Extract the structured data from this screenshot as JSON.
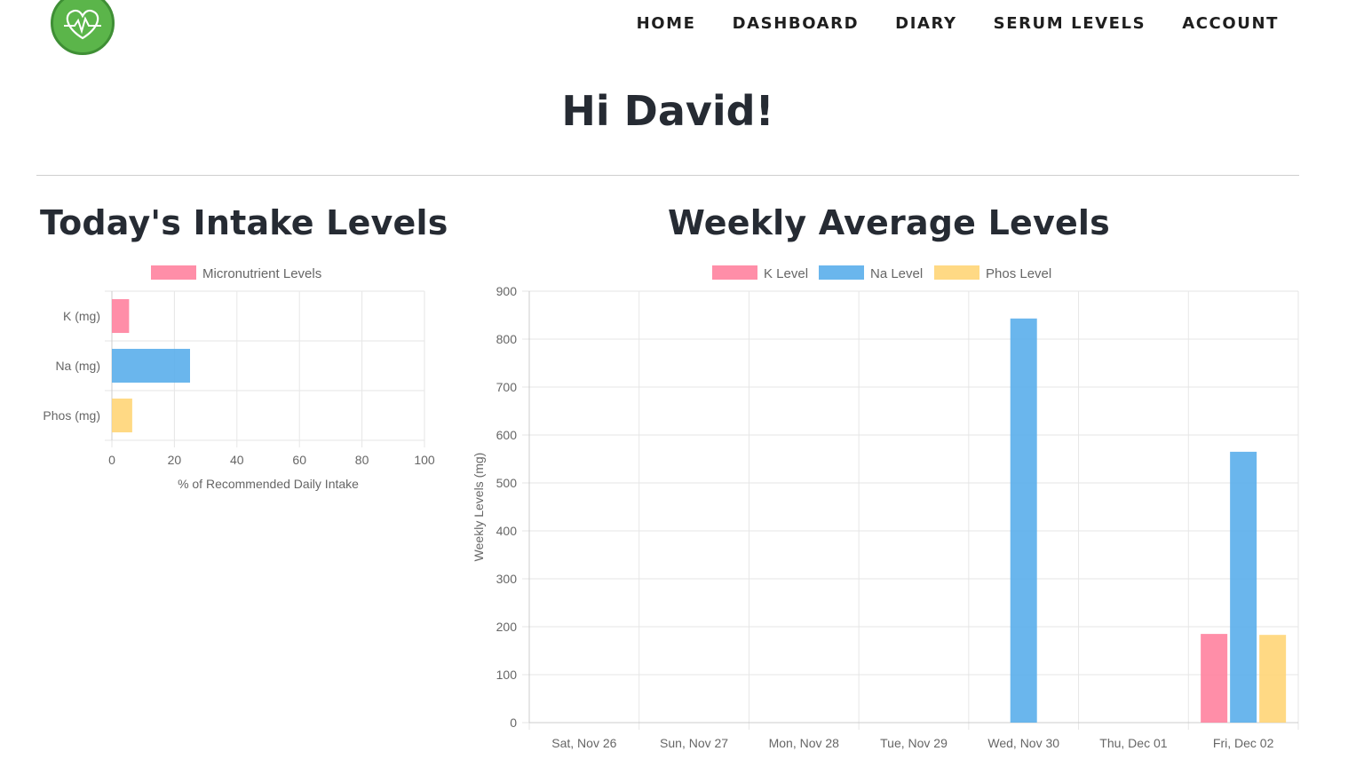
{
  "nav": {
    "items": [
      "HOME",
      "DASHBOARD",
      "DIARY",
      "SERUM LEVELS",
      "ACCOUNT"
    ]
  },
  "greeting": "Hi David!",
  "sections": {
    "today_title": "Today's Intake Levels",
    "weekly_title": "Weekly Average Levels"
  },
  "colors": {
    "logo": "#5bb54a",
    "k": "#ff829f",
    "na": "#5aaeeb",
    "phos": "#ffd577"
  },
  "chart_data": [
    {
      "type": "bar",
      "orientation": "horizontal",
      "categories": [
        "K (mg)",
        "Na (mg)",
        "Phos (mg)"
      ],
      "series": [
        {
          "name": "Micronutrient Levels",
          "values": [
            5.5,
            25,
            6.5
          ],
          "colors": [
            "#ff829f",
            "#5aaeeb",
            "#ffd577"
          ]
        }
      ],
      "xlabel": "% of Recommended Daily Intake",
      "ylabel": "",
      "xlim": [
        0,
        100
      ],
      "xticks": [
        0,
        20,
        40,
        60,
        80,
        100
      ],
      "legend": "top",
      "grid": true
    },
    {
      "type": "bar",
      "categories": [
        "Sat, Nov 26",
        "Sun, Nov 27",
        "Mon, Nov 28",
        "Tue, Nov 29",
        "Wed, Nov 30",
        "Thu, Dec 01",
        "Fri, Dec 02"
      ],
      "series": [
        {
          "name": "K Level",
          "color": "#ff829f",
          "values": [
            0,
            0,
            0,
            0,
            0,
            0,
            185
          ]
        },
        {
          "name": "Na Level",
          "color": "#5aaeeb",
          "values": [
            0,
            0,
            0,
            0,
            843,
            0,
            565
          ]
        },
        {
          "name": "Phos Level",
          "color": "#ffd577",
          "values": [
            0,
            0,
            0,
            0,
            0,
            0,
            183
          ]
        }
      ],
      "xlabel": "",
      "ylabel": "Weekly Levels (mg)",
      "ylim": [
        0,
        900
      ],
      "yticks": [
        0,
        100,
        200,
        300,
        400,
        500,
        600,
        700,
        800,
        900
      ],
      "legend": "top",
      "grid": true
    }
  ]
}
